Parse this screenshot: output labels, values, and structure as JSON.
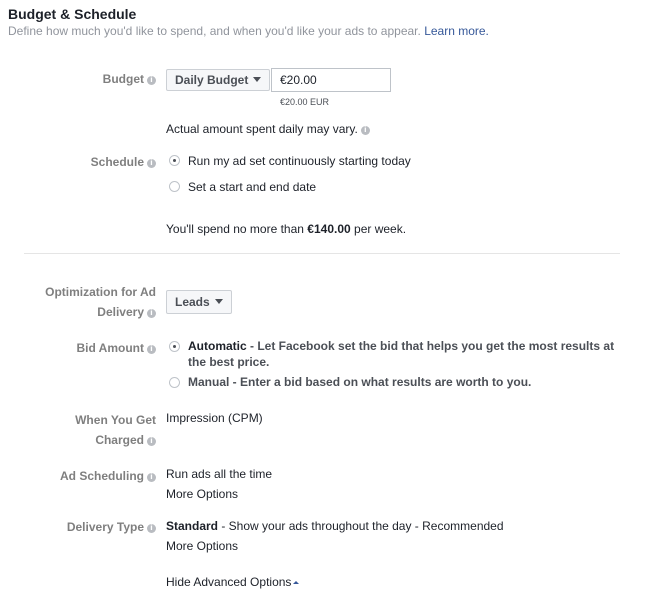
{
  "section": {
    "title": "Budget & Schedule",
    "subtitle": "Define how much you'd like to spend, and when you'd like your ads to appear.",
    "learn_more": "Learn more."
  },
  "budget": {
    "label": "Budget",
    "type_dropdown": "Daily Budget",
    "amount": "€20.00",
    "amount_hint": "€20.00 EUR",
    "note": "Actual amount spent daily may vary."
  },
  "schedule": {
    "label": "Schedule",
    "options": [
      {
        "label": "Run my ad set continuously starting today",
        "selected": true
      },
      {
        "label": "Set a start and end date",
        "selected": false
      }
    ],
    "spend_prefix": "You'll spend no more than",
    "spend_amount": "€140.00",
    "spend_suffix": "per week."
  },
  "optimization": {
    "label_line1": "Optimization for Ad",
    "label_line2": "Delivery",
    "dropdown": "Leads"
  },
  "bid_amount": {
    "label": "Bid Amount",
    "options": [
      {
        "title": "Automatic",
        "desc_line1": " - Let Facebook set the bid that helps you get the most results at",
        "desc_line2": "the best price.",
        "selected": true
      },
      {
        "title": "Manual",
        "desc_line1": " - Enter a bid based on what results are worth to you.",
        "selected": false
      }
    ]
  },
  "charged": {
    "label_line1": "When You Get",
    "label_line2": "Charged",
    "value": "Impression (CPM)"
  },
  "ad_scheduling": {
    "label": "Ad Scheduling",
    "value": "Run ads all the time",
    "more": "More Options"
  },
  "delivery_type": {
    "label": "Delivery Type",
    "value_bold": "Standard",
    "value_rest": " - Show your ads throughout the day - Recommended",
    "more": "More Options"
  },
  "hide_advanced": "Hide Advanced Options",
  "colors": {
    "link": "#365899",
    "label": "#7f7f7f",
    "divider": "#e5e5e5"
  }
}
